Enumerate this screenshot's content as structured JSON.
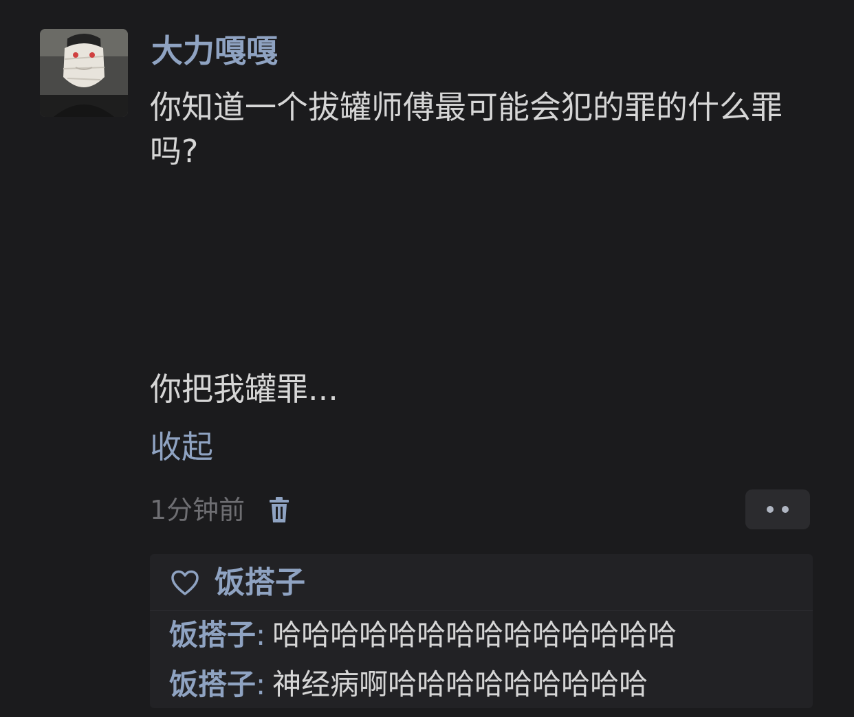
{
  "post": {
    "author": "大力嘎嘎",
    "text": "你知道一个拔罐师傅最可能会犯的罪的什么罪吗?",
    "punchline": "你把我罐罪...",
    "collapse_label": "收起",
    "timestamp": "1分钟前"
  },
  "icons": {
    "avatar": "avatar-photo",
    "delete": "trash-icon",
    "more": "more-dots-icon",
    "like": "heart-icon"
  },
  "likes": {
    "names": "饭搭子"
  },
  "comments": [
    {
      "author": "饭搭子",
      "separator": ":",
      "text": "哈哈哈哈哈哈哈哈哈哈哈哈哈哈"
    },
    {
      "author": "饭搭子",
      "separator": ":",
      "text": "神经病啊哈哈哈哈哈哈哈哈哈"
    }
  ],
  "colors": {
    "background": "#1b1b1d",
    "link": "#8fa3c2",
    "text": "#d6d6d6",
    "muted": "#6e6e72",
    "panel": "#222225"
  }
}
